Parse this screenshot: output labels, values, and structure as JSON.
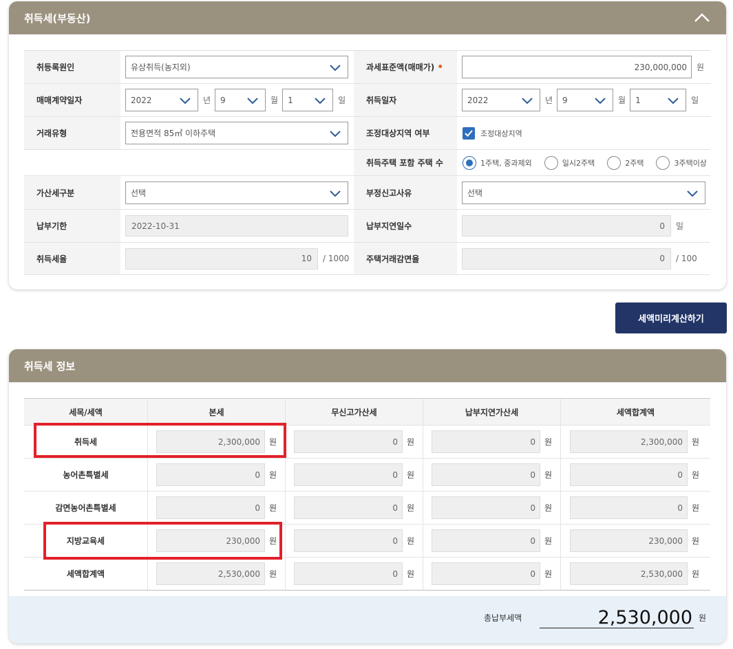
{
  "panel1": {
    "title": "취득세(부동산)",
    "rows": {
      "cause": {
        "label": "취등록원인",
        "value": "유상취득(농지외)"
      },
      "taxbase": {
        "label": "과세표준액(매매가)",
        "required_mark": "•",
        "value": "230,000,000",
        "unit": "원"
      },
      "contract": {
        "label": "매매계약일자",
        "year": "2022",
        "year_unit": "년",
        "month": "9",
        "month_unit": "월",
        "day": "1",
        "day_unit": "일"
      },
      "acquire": {
        "label": "취득일자",
        "year": "2022",
        "year_unit": "년",
        "month": "9",
        "month_unit": "월",
        "day": "1",
        "day_unit": "일"
      },
      "deal": {
        "label": "거래유형",
        "value": "전용면적 85㎡ 이하주택"
      },
      "adjust": {
        "label": "조정대상지역 여부",
        "checkbox_label": "조정대상지역",
        "checked": true
      },
      "houses": {
        "label": "취득주택 포함 주택 수",
        "options": [
          "1주택, 중과제외",
          "일시2주택",
          "2주택",
          "3주택이상"
        ],
        "selected": 0
      },
      "surtax": {
        "label": "가산세구분",
        "value": "선택"
      },
      "improper": {
        "label": "부정신고사유",
        "value": "선택"
      },
      "deadline": {
        "label": "납부기한",
        "value": "2022-10-31"
      },
      "delay": {
        "label": "납부지연일수",
        "value": "0",
        "unit": "일"
      },
      "rate": {
        "label": "취득세율",
        "value": "10",
        "unit": "/ 1000"
      },
      "reduction": {
        "label": "주택거래감면율",
        "value": "0",
        "unit": "/ 100"
      }
    }
  },
  "calc_button": "세액미리계산하기",
  "panel2": {
    "title": "취득세 정보",
    "columns": [
      "세목/세액",
      "본세",
      "무신고가산세",
      "납부지연가산세",
      "세액합계액"
    ],
    "unit": "원",
    "rows": [
      {
        "name": "취득세",
        "values": [
          "2,300,000",
          "0",
          "0",
          "2,300,000"
        ]
      },
      {
        "name": "농어촌특별세",
        "values": [
          "0",
          "0",
          "0",
          "0"
        ]
      },
      {
        "name": "감면농어촌특별세",
        "values": [
          "0",
          "0",
          "0",
          "0"
        ]
      },
      {
        "name": "지방교육세",
        "values": [
          "230,000",
          "0",
          "0",
          "230,000"
        ]
      },
      {
        "name": "세액합계액",
        "values": [
          "2,530,000",
          "0",
          "0",
          "2,530,000"
        ]
      }
    ],
    "total_label": "총납부세액",
    "total_amount": "2,530,000",
    "total_unit": "원"
  },
  "colors": {
    "header": "#9b917f",
    "button": "#223566",
    "accent": "#2e6fbd",
    "highlight": "#e2202a"
  }
}
